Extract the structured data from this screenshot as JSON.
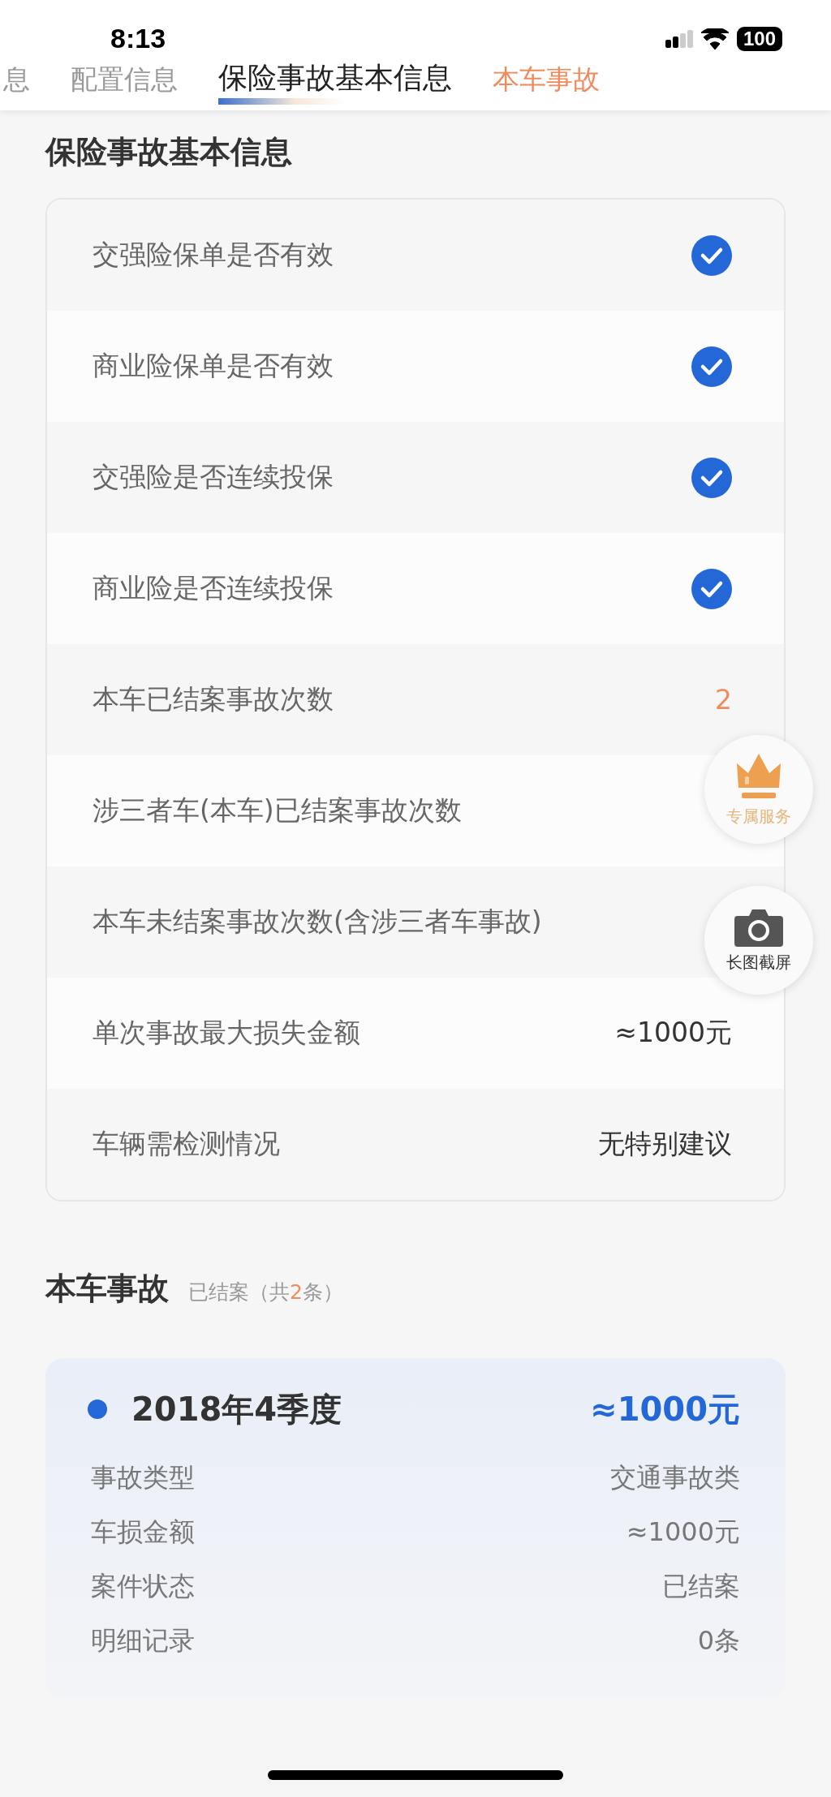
{
  "status_bar": {
    "time": "8:13",
    "battery": "100"
  },
  "tabs": [
    {
      "label": "息",
      "selected": false,
      "kind": "plain"
    },
    {
      "label": "配置信息",
      "selected": false,
      "kind": "plain"
    },
    {
      "label": "保险事故基本信息",
      "selected": true,
      "kind": "plain"
    },
    {
      "label": "本车事故",
      "selected": false,
      "kind": "accent"
    }
  ],
  "basic_info": {
    "title": "保险事故基本信息",
    "rows": [
      {
        "label": "交强险保单是否有效",
        "kind": "check",
        "checked": true
      },
      {
        "label": "商业险保单是否有效",
        "kind": "check",
        "checked": true
      },
      {
        "label": "交强险是否连续投保",
        "kind": "check",
        "checked": true
      },
      {
        "label": "商业险是否连续投保",
        "kind": "check",
        "checked": true
      },
      {
        "label": "本车已结案事故次数",
        "kind": "count",
        "value": "2"
      },
      {
        "label": "涉三者车(本车)已结案事故次数",
        "kind": "text"
      },
      {
        "label": "本车未结案事故次数(含涉三者车事故)",
        "kind": "text"
      },
      {
        "label": "单次事故最大损失金额",
        "kind": "text",
        "value": "≈1000元"
      },
      {
        "label": "车辆需检测情况",
        "kind": "text",
        "value": "无特别建议"
      }
    ]
  },
  "floating_buttons": [
    {
      "kind": "crown",
      "label": "专属服务"
    },
    {
      "kind": "camera",
      "label": "长图截屏"
    }
  ],
  "accidents": {
    "title": "本车事故",
    "status": "已结案",
    "count_prefix": "（共",
    "count": "2",
    "count_suffix": "条）",
    "items": [
      {
        "period": "2018年4季度",
        "amount": "≈1000元",
        "details": [
          {
            "label": "事故类型",
            "value": "交通事故类"
          },
          {
            "label": "车损金额",
            "value": "≈1000元"
          },
          {
            "label": "案件状态",
            "value": "已结案"
          },
          {
            "label": "明细记录",
            "value": "0条"
          }
        ]
      }
    ]
  }
}
